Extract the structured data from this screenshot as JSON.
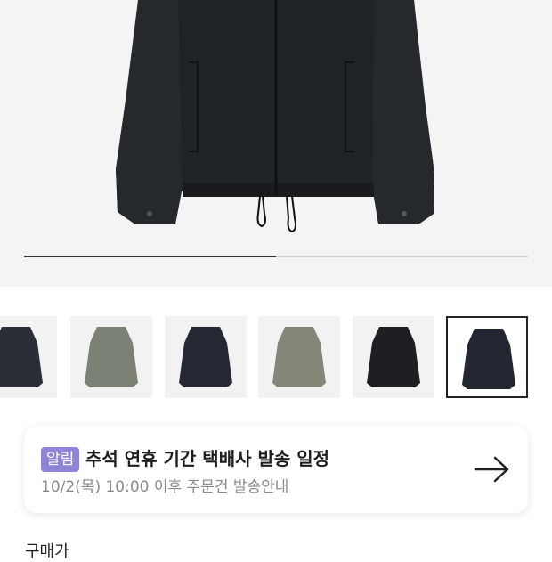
{
  "gallery": {
    "progress_fraction": 0.5,
    "thumbnails": [
      {
        "name": "thumb-1",
        "color": "#2a2e36",
        "selected": false
      },
      {
        "name": "thumb-2",
        "color": "#7b8174",
        "selected": false
      },
      {
        "name": "thumb-3",
        "color": "#242833",
        "selected": false
      },
      {
        "name": "thumb-4",
        "color": "#828778",
        "selected": false
      },
      {
        "name": "thumb-5",
        "color": "#1e1f22",
        "selected": false
      },
      {
        "name": "thumb-6",
        "color": "#222630",
        "selected": true
      }
    ]
  },
  "notice": {
    "badge": "알림",
    "title": "추석 연휴 기간 택배사 발송 일정",
    "subtitle": "10/2(목) 10:00 이후 주문건 발송안내",
    "arrow_icon": "arrow-right-icon",
    "badge_color": "#8f85d6"
  },
  "next_section": {
    "label": "구매가"
  }
}
